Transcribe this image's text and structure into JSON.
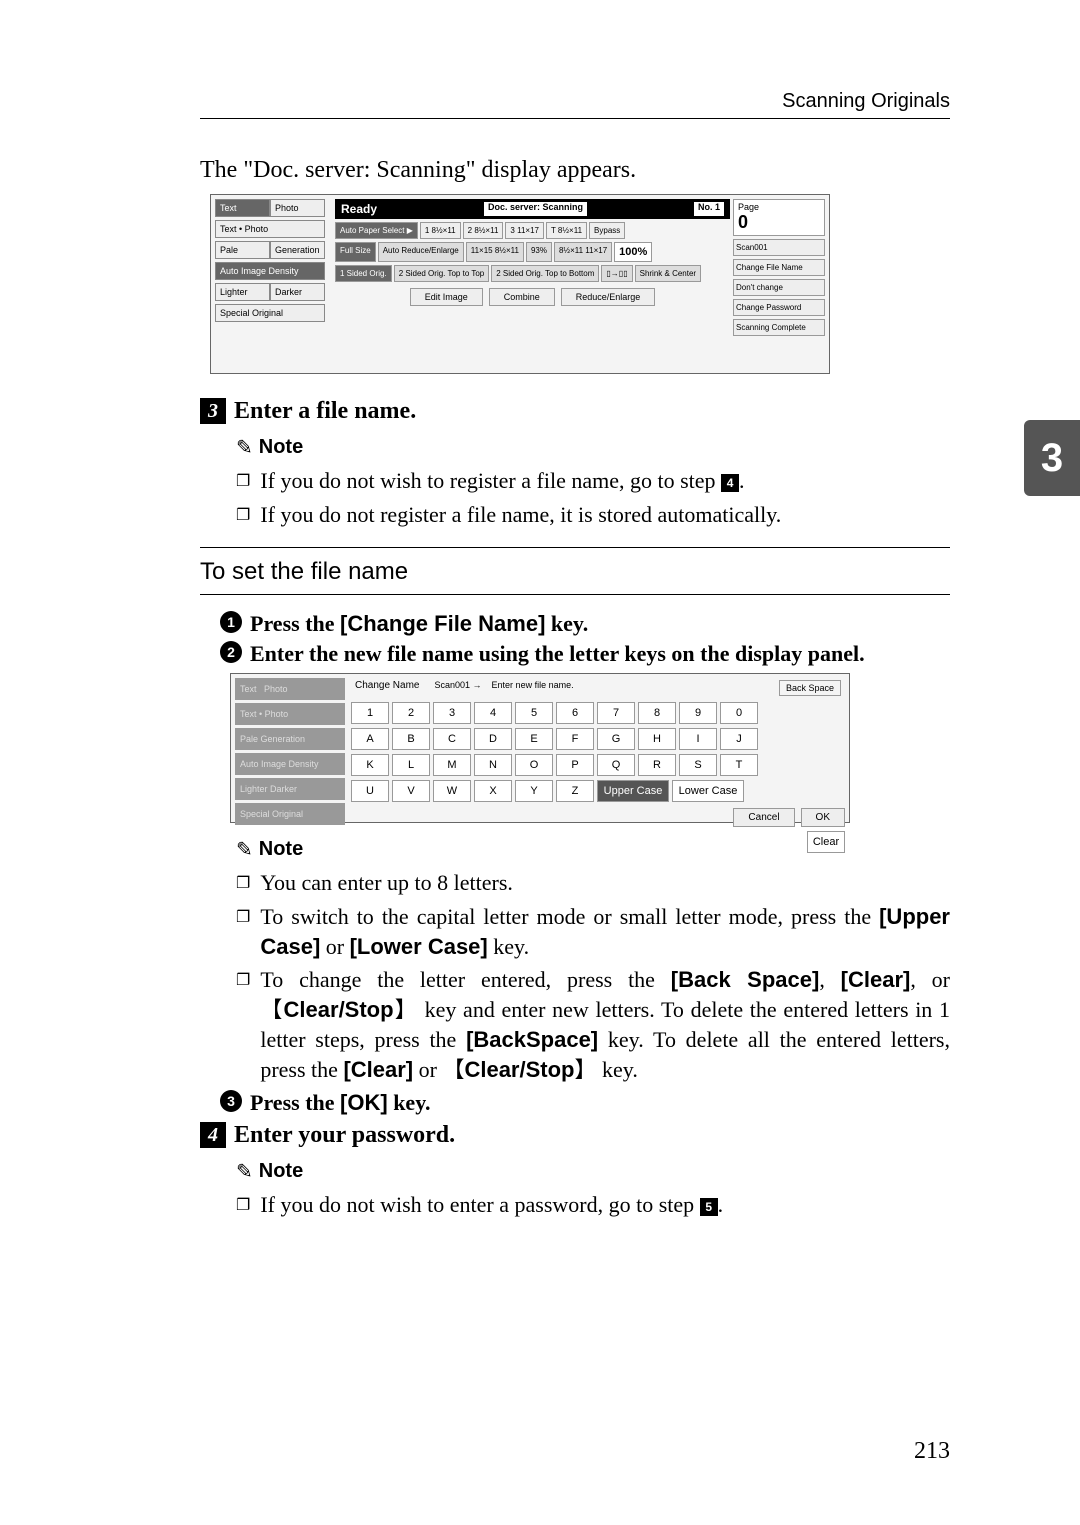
{
  "header": {
    "section": "Scanning Originals"
  },
  "intro": "The \"Doc. server: Scanning\" display appears.",
  "side_tab": "3",
  "page_number": "213",
  "sb1": {
    "ready": "Ready",
    "doc_server": "Doc. server: Scanning",
    "no": "No. 1",
    "page_label": "Page",
    "page_value": "0",
    "left_tabs": {
      "text": "Text",
      "photo": "Photo",
      "textphoto": "Text • Photo",
      "pale": "Pale",
      "gen": "Generation",
      "density": "Auto Image Density",
      "lighter": "Lighter",
      "darker": "Darker",
      "special": "Special Original"
    },
    "mid": {
      "auto_paper": "Auto Paper Select ▶",
      "s1": "1 8½×11",
      "s2": "2 8½×11",
      "s3": "3 11×17",
      "s4": "T 8½×11",
      "bypass": "Bypass",
      "full": "Full Size",
      "are": "Auto Reduce/Enlarge",
      "r1": "11×15 8½×11",
      "r2": "93%",
      "r3": "8½×11 11×17",
      "pct": "100%",
      "sided": "1 Sided Orig.",
      "tt": "2 Sided Orig. Top to Top",
      "tb": "2 Sided Orig. Top to Bottom",
      "shrink": "Shrink & Center",
      "edit": "Edit Image",
      "combine": "Combine",
      "re": "Reduce/Enlarge"
    },
    "right": {
      "scan": "Scan001",
      "cfn": "Change File Name",
      "dc": "Don't change",
      "cp": "Change Password",
      "sc": "Scanning Complete"
    }
  },
  "step3": {
    "num": "3",
    "text": "Enter a file name."
  },
  "note_label": "Note",
  "step3_notes": {
    "n1_pre": "If you do not wish to register a file name, go to step ",
    "n1_ref": "4",
    "n1_post": ".",
    "n2": "If you do not register a file name, it is stored automatically."
  },
  "section": {
    "title": "To set the file name"
  },
  "sub1": {
    "pre": "Press the ",
    "key": "[Change File Name]",
    "post": " key."
  },
  "sub2": {
    "text": "Enter the new file name using the letter keys on the display panel."
  },
  "kb": {
    "left": {
      "text": "Text",
      "photo": "Photo",
      "tp": "Text • Photo",
      "pale": "Pale",
      "gen": "Generation",
      "aid": "Auto Image Density",
      "li": "Lighter",
      "da": "Darker",
      "so": "Special Original"
    },
    "change_name": "Change Name",
    "scan": "Scan001",
    "enter": "Enter new file name.",
    "backspace": "Back Space",
    "row1": [
      "1",
      "2",
      "3",
      "4",
      "5",
      "6",
      "7",
      "8",
      "9",
      "0"
    ],
    "row2": [
      "A",
      "B",
      "C",
      "D",
      "E",
      "F",
      "G",
      "H",
      "I",
      "J"
    ],
    "row3": [
      "K",
      "L",
      "M",
      "N",
      "O",
      "P",
      "Q",
      "R",
      "S",
      "T"
    ],
    "row4": [
      "U",
      "V",
      "W",
      "X",
      "Y",
      "Z"
    ],
    "upper": "Upper Case",
    "lower": "Lower Case",
    "clear": "Clear",
    "cancel": "Cancel",
    "ok": "OK"
  },
  "sub2_notes": {
    "n1": "You can enter up to 8 letters.",
    "n2_pre": "To switch to the capital letter mode or small letter mode, press the ",
    "n2_k1": "[Upper Case]",
    "n2_mid": " or ",
    "n2_k2": "[Lower Case]",
    "n2_post": " key.",
    "n3_a": "To change the letter entered, press the ",
    "n3_k1": "[Back Space]",
    "n3_b": ", ",
    "n3_k2": "[Clear]",
    "n3_c": ", or 【",
    "n3_k3": "Clear/Stop",
    "n3_d": "】 key and enter new letters. To delete the entered letters in 1 letter steps, press the ",
    "n3_k4": "[BackSpace]",
    "n3_e": " key. To delete all the entered letters, press the ",
    "n3_k5": "[Clear]",
    "n3_f": " or 【",
    "n3_k6": "Clear/Stop",
    "n3_g": "】 key."
  },
  "sub3": {
    "pre": "Press the ",
    "key": "[OK]",
    "post": " key."
  },
  "step4": {
    "num": "4",
    "text": "Enter your password."
  },
  "step4_notes": {
    "n1_pre": "If you do not wish to enter a password, go to step ",
    "n1_ref": "5",
    "n1_post": "."
  }
}
